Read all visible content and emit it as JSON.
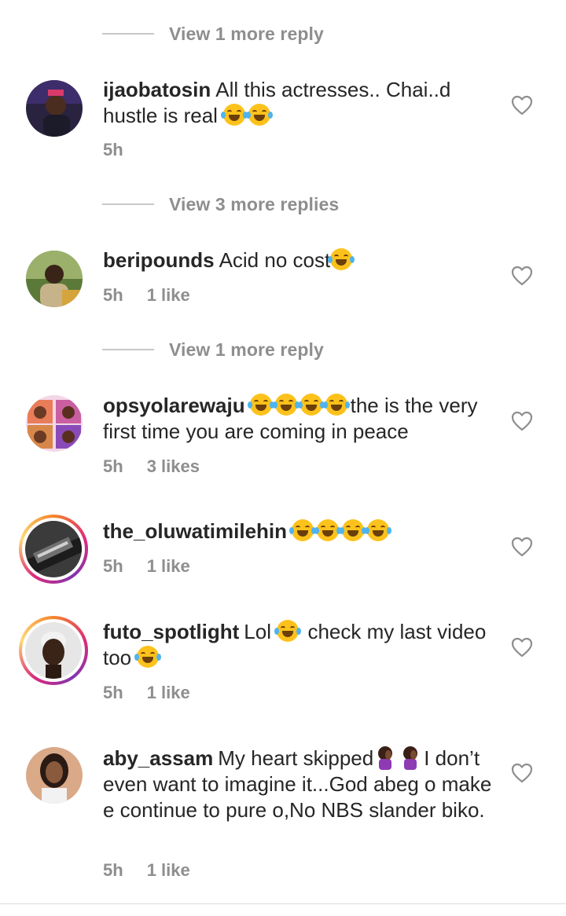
{
  "view_more_rows": [
    {
      "label": "View 1 more reply"
    },
    {
      "label": "View 3 more replies"
    },
    {
      "label": "View 1 more reply"
    }
  ],
  "comments": [
    {
      "username": "ijaobatosin",
      "text": "All this actresses.. Chai..d hustle is real",
      "emoji_after": "😂😂",
      "time": "5h",
      "likes": "",
      "avatar_ring": false
    },
    {
      "username": "beripounds",
      "text": "Acid no cost",
      "emoji_after": "😂",
      "time": "5h",
      "likes": "1 like",
      "avatar_ring": false
    },
    {
      "username": "opsyolarewaju",
      "text_before_emoji": "",
      "emoji": "😂😂😂😂",
      "text": "the is the very first time you are coming in peace",
      "time": "5h",
      "likes": "3 likes",
      "avatar_ring": false
    },
    {
      "username": "the_oluwatimilehin",
      "emoji": "😂😂😂😂",
      "text": "",
      "time": "5h",
      "likes": "1 like",
      "avatar_ring": true
    },
    {
      "username": "futo_spotlight",
      "text_part1": "Lol",
      "text_part2": "check my last video too",
      "emoji": "😂",
      "time": "5h",
      "likes": "1 like",
      "avatar_ring": true
    },
    {
      "username": "aby_assam",
      "text_part1": "My heart skipped",
      "emoji": "🤦🏾‍♀️🤦🏾‍♀️",
      "text_part2": "I don’t even want to imagine it...God abeg o make e continue to pure o,No NBS slander biko.",
      "time": "5h",
      "likes": "1 like",
      "avatar_ring": false
    }
  ],
  "icons": {
    "like": "heart-outline-icon"
  },
  "colors": {
    "text": "#262626",
    "secondary": "#8e8e8e",
    "divider": "#c7c7c7"
  }
}
